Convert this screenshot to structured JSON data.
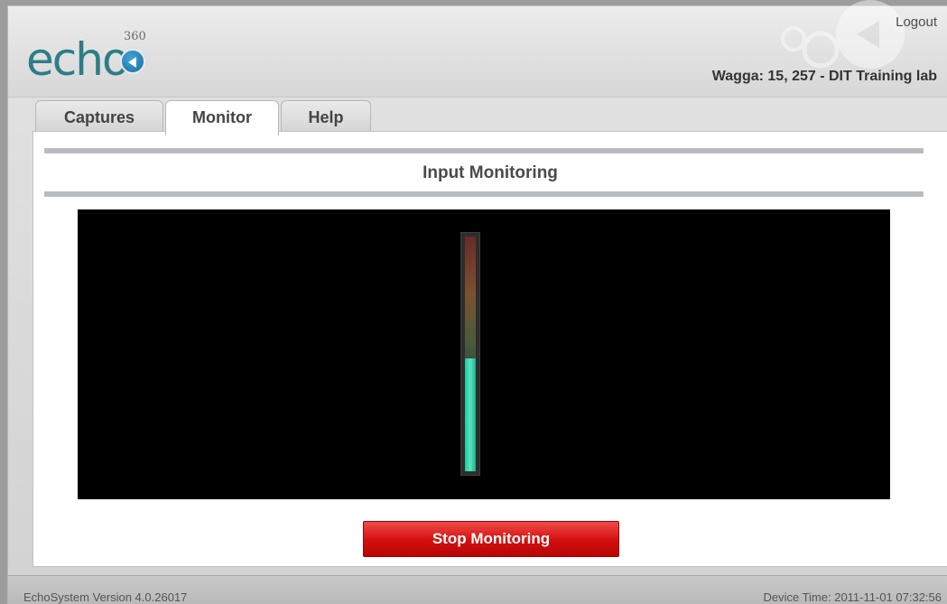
{
  "header": {
    "logo_text": "echo",
    "logo_superscript": "360",
    "logout_label": "Logout",
    "room_label": "Wagga: 15, 257 - DIT Training lab"
  },
  "tabs": [
    {
      "label": "Captures",
      "active": false
    },
    {
      "label": "Monitor",
      "active": true
    },
    {
      "label": "Help",
      "active": false
    }
  ],
  "main": {
    "section_title": "Input Monitoring",
    "audio_level_fraction": 0.48,
    "stop_button_label": "Stop Monitoring"
  },
  "footer": {
    "version": "EchoSystem Version 4.0.26017",
    "device_time": "Device Time: 2011-11-01 07:32:56"
  },
  "colors": {
    "brand_teal": "#2d7d86",
    "stop_red": "#d30e0e",
    "meter_fill": "#21c59a"
  },
  "icons": [
    "echo-play-icon",
    "watermark-icon"
  ]
}
